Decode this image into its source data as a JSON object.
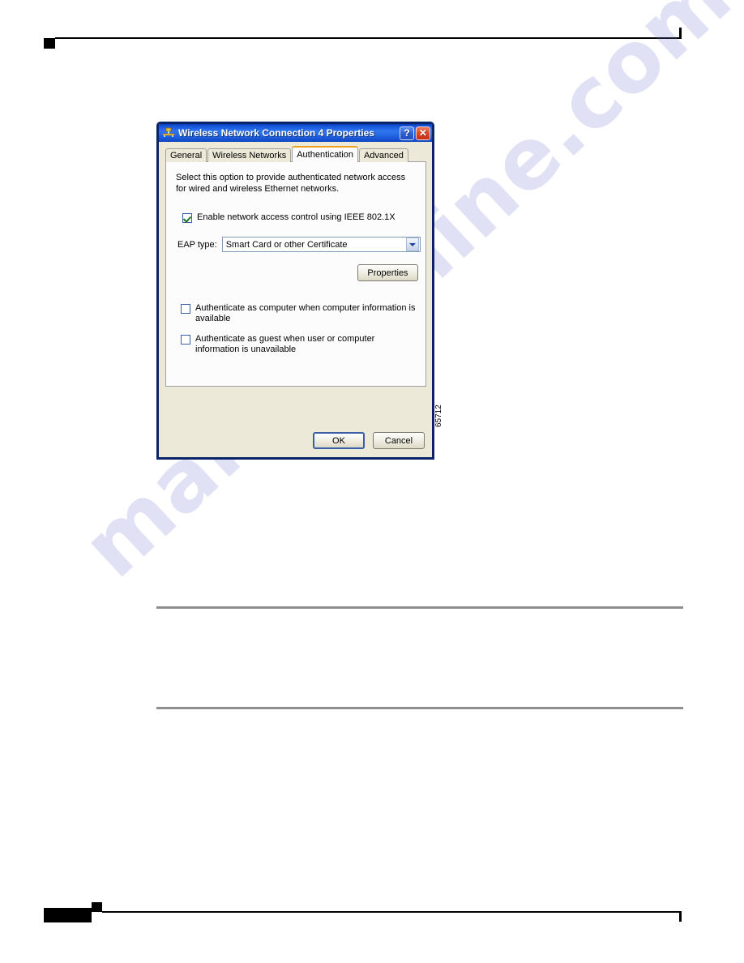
{
  "page": {
    "figure_id": "65712",
    "watermark": "manualshine.com"
  },
  "dialog": {
    "title": "Wireless Network Connection 4 Properties",
    "title_icon": "network-adapter-icon",
    "help_button": "?",
    "close_button": "✕",
    "tabs": [
      {
        "label": "General",
        "active": false
      },
      {
        "label": "Wireless Networks",
        "active": false
      },
      {
        "label": "Authentication",
        "active": true
      },
      {
        "label": "Advanced",
        "active": false
      }
    ],
    "panel": {
      "intro": "Select this option to provide authenticated network access for wired and wireless Ethernet networks.",
      "enable_checkbox": {
        "label": "Enable network access control using IEEE 802.1X",
        "checked": true
      },
      "eap": {
        "label": "EAP type:",
        "value": "Smart Card or other Certificate",
        "dropdown_icon": "chevron-down-icon"
      },
      "properties_button": "Properties",
      "auth_computer_checkbox": {
        "label": "Authenticate as computer when computer information is available",
        "checked": false
      },
      "auth_guest_checkbox": {
        "label": "Authenticate as guest when user or computer information is unavailable",
        "checked": false
      }
    },
    "footer": {
      "ok_button": "OK",
      "cancel_button": "Cancel"
    }
  },
  "colors": {
    "titlebar_blue": "#1353d8",
    "dialog_border": "#0a246a",
    "dialog_face": "#ece9d8",
    "active_tab_accent": "#f0a020",
    "check_green": "#137a23",
    "close_red": "#e14b28",
    "watermark_violet": "#7878d7",
    "rule_gray": "#8e8e8e"
  }
}
